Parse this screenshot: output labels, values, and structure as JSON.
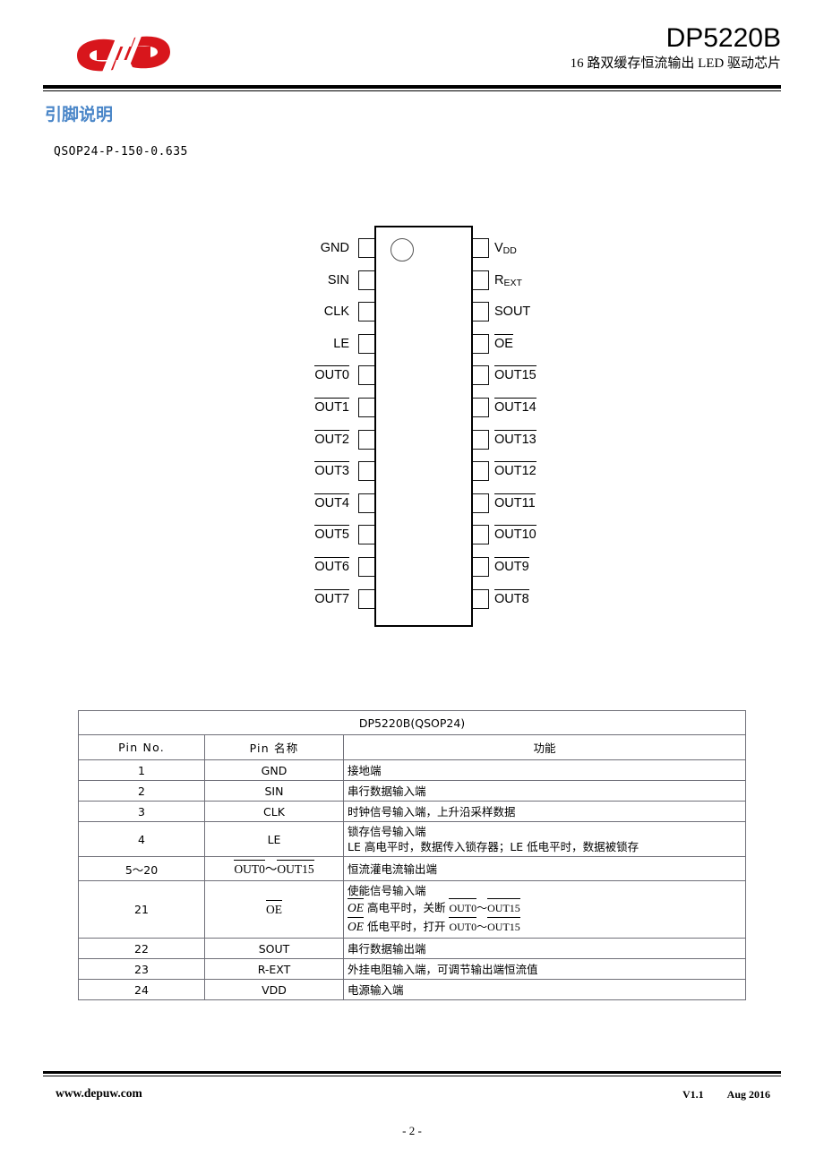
{
  "header": {
    "logo_alt": "depuw-logo",
    "title": "DP5220B",
    "subtitle": "16 路双缓存恒流输出 LED 驱动芯片"
  },
  "section": {
    "heading": "引脚说明",
    "package": "QSOP24-P-150-0.635"
  },
  "diagram": {
    "left_pins": [
      {
        "label": "GND",
        "overline": false
      },
      {
        "label": "SIN",
        "overline": false
      },
      {
        "label": "CLK",
        "overline": false
      },
      {
        "label": "LE",
        "overline": false
      },
      {
        "label": "OUT0",
        "overline": true
      },
      {
        "label": "OUT1",
        "overline": true
      },
      {
        "label": "OUT2",
        "overline": true
      },
      {
        "label": "OUT3",
        "overline": true
      },
      {
        "label": "OUT4",
        "overline": true
      },
      {
        "label": "OUT5",
        "overline": true
      },
      {
        "label": "OUT6",
        "overline": true
      },
      {
        "label": "OUT7",
        "overline": true
      }
    ],
    "right_pins": [
      {
        "label": "V",
        "sub": "DD",
        "overline": false
      },
      {
        "label": "R",
        "sub": "EXT",
        "overline": false
      },
      {
        "label": "SOUT",
        "sub": "",
        "overline": false
      },
      {
        "label": "OE",
        "sub": "",
        "overline": true
      },
      {
        "label": "OUT15",
        "sub": "",
        "overline": true
      },
      {
        "label": "OUT14",
        "sub": "",
        "overline": true
      },
      {
        "label": "OUT13",
        "sub": "",
        "overline": true
      },
      {
        "label": "OUT12",
        "sub": "",
        "overline": true
      },
      {
        "label": "OUT11",
        "sub": "",
        "overline": true
      },
      {
        "label": "OUT10",
        "sub": "",
        "overline": true
      },
      {
        "label": "OUT9",
        "sub": "",
        "overline": true
      },
      {
        "label": "OUT8",
        "sub": "",
        "overline": true
      }
    ]
  },
  "table": {
    "title": "DP5220B(QSOP24)",
    "columns": [
      "Pin No.",
      "Pin 名称",
      "功能"
    ],
    "rows": [
      {
        "no": "1",
        "name": "GND",
        "fn": [
          "接地端"
        ]
      },
      {
        "no": "2",
        "name": "SIN",
        "fn": [
          "串行数据输入端"
        ]
      },
      {
        "no": "3",
        "name": "CLK",
        "fn": [
          "时钟信号输入端，上升沿采样数据"
        ]
      },
      {
        "no": "4",
        "name": "LE",
        "fn": [
          "锁存信号输入端",
          "LE 高电平时，数据传入锁存器；LE 低电平时，数据被锁存"
        ]
      },
      {
        "no": "5～20",
        "name": "OUT0～OUT15",
        "fn": [
          "恒流灌电流输出端"
        ]
      },
      {
        "no": "21",
        "name": "OE",
        "fn": [
          "使能信号输入端",
          "OE 高电平时，关断 OUT0～OUT15",
          "OE 低电平时，打开 OUT0～OUT15"
        ]
      },
      {
        "no": "22",
        "name": "SOUT",
        "fn": [
          "串行数据输出端"
        ]
      },
      {
        "no": "23",
        "name": "R-EXT",
        "fn": [
          "外挂电阻输入端，可调节输出端恒流值"
        ]
      },
      {
        "no": "24",
        "name": "VDD",
        "fn": [
          "电源输入端"
        ]
      }
    ]
  },
  "footer": {
    "website": "www.depuw.com",
    "version": "V1.1",
    "date": "Aug 2016",
    "page_number": "- 2 -"
  },
  "colors": {
    "heading_blue": "#4a86c8",
    "logo_red": "#d8161c",
    "rule_black": "#000000",
    "table_border": "#6f6f78"
  }
}
